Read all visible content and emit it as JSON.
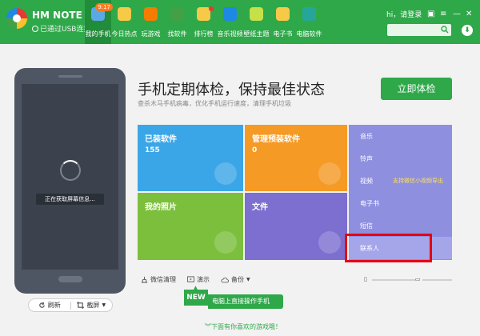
{
  "device": {
    "name": "HM NOTE ...",
    "connection": "已通过USB连接"
  },
  "nav": [
    {
      "label": "我的手机",
      "icon": "phone-icon",
      "badge": "9.17",
      "active": true,
      "color": "#5aa9e6"
    },
    {
      "label": "今日热点",
      "icon": "star-icon",
      "color": "#f7c948"
    },
    {
      "label": "玩游戏",
      "icon": "gamepad-icon",
      "color": "#f57c00"
    },
    {
      "label": "找软件",
      "icon": "apps-icon",
      "color": "#43a047"
    },
    {
      "label": "排行榜",
      "icon": "trophy-icon",
      "color": "#f7c948",
      "dot": true
    },
    {
      "label": "音乐视频",
      "icon": "play-icon",
      "color": "#1e88e5"
    },
    {
      "label": "壁纸主题",
      "icon": "wallpaper-icon",
      "color": "#c6e048"
    },
    {
      "label": "电子书",
      "icon": "book-icon",
      "color": "#f7c948"
    },
    {
      "label": "电脑软件",
      "icon": "monitor-icon",
      "color": "#26a69a"
    }
  ],
  "header": {
    "login": "hi，请登录"
  },
  "phone": {
    "status": "正在获取屏幕信息..."
  },
  "phone_actions": {
    "refresh": "刷新",
    "screenshot": "截屏"
  },
  "main": {
    "title": "手机定期体检，保持最佳状态",
    "subtitle": "查杀木马手机病毒，优化手机运行速度，清理手机垃圾",
    "checkup_button": "立即体检"
  },
  "tiles": {
    "installed": {
      "label": "已装软件",
      "count": "155"
    },
    "preinstalled": {
      "label": "管理预装软件",
      "count": "0"
    },
    "photos": {
      "label": "我的照片"
    },
    "files": {
      "label": "文件"
    }
  },
  "side_list": [
    {
      "label": "音乐"
    },
    {
      "label": "铃声"
    },
    {
      "label": "视频",
      "tag": "支持微信小视频导出"
    },
    {
      "label": "电子书"
    },
    {
      "label": "短信"
    },
    {
      "label": "联系人",
      "highlighted": true
    }
  ],
  "tools": {
    "wechat": "微信清理",
    "demo": "演示",
    "backup": "备份"
  },
  "promo": {
    "badge": "NEW",
    "text": "电脑上直接操作手机"
  },
  "footer": {
    "link": "下面有你喜欢的游戏哦！"
  },
  "colors": {
    "brand": "#2fa84a",
    "highlight": "#e30613"
  }
}
